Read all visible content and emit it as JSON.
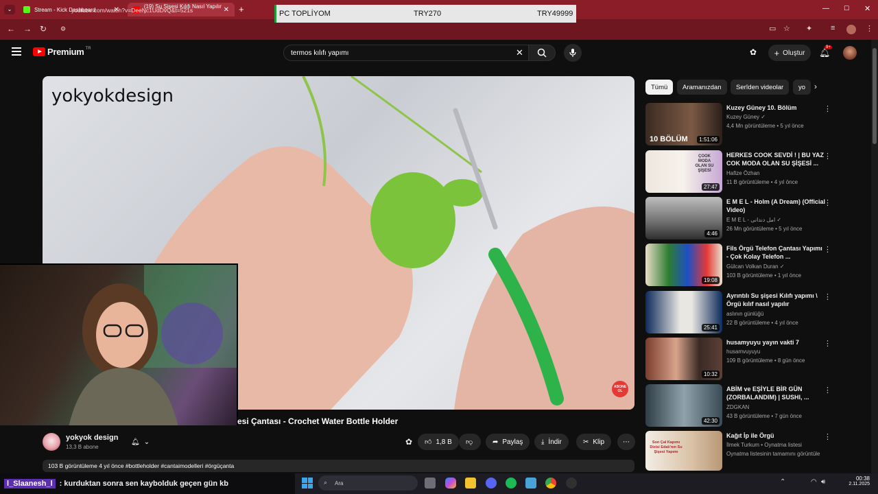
{
  "browser": {
    "tabs": [
      {
        "title": "Stream - Kick Dashboard",
        "color": "#53fc18"
      },
      {
        "title": "(19) Su Şişesi Kılıfı Nasıl Yapılır -",
        "color": "#ff0000"
      }
    ],
    "url": "youtube.com/watch?v=DeeNc1UdDvQ&t=521s"
  },
  "ad_overlay": {
    "label": "PC TOPLİYOM",
    "current": "TRY270",
    "goal": "TRY49999"
  },
  "youtube": {
    "logo_label": "Premium",
    "logo_region": "TR",
    "search_query": "termos kılıfı yapımı",
    "create_label": "Oluştur",
    "notif_count": "9+"
  },
  "video": {
    "watermark": "yokyokdesign",
    "title_visible": "esi Çantası - Crochet Water Bottle Holder",
    "channel": "yokyok design",
    "subs": "13,3 B abone",
    "likes": "1,8 B",
    "share_label": "Paylaş",
    "download_label": "İndir",
    "clip_label": "Klip",
    "description": "103 B görüntüleme  4 yıl önce  #bottleholder #cantaimodelleri #örgüçanta",
    "subscribe_badge": "ABONE OL"
  },
  "sidebar": {
    "chips": [
      "Tümü",
      "Aramanızdan",
      "Serîden videolar",
      "yo"
    ],
    "recos": [
      {
        "title": "Kuzey Güney 10. Bölüm",
        "channel": "Kuzey Güney ✓",
        "meta": "4,4 Mn görüntüleme • 5 yıl önce",
        "duration": "1:51:06",
        "color": "#5b3f2f"
      },
      {
        "title": "HERKES COOK SEVDİ ! | BU YAZ COK MODA OLAN SU ŞİŞESİ ...",
        "channel": "Hafize Özhan",
        "meta": "11 B görüntüleme • 4 yıl önce",
        "duration": "27:47",
        "color": "#e9e3dc"
      },
      {
        "title": "E M E L - Holm (A Dream) (Official Video)",
        "channel": "E M E L - امل دندانی ✓",
        "meta": "26 Mn görüntüleme • 5 yıl önce",
        "duration": "4:46",
        "color": "#777"
      },
      {
        "title": "Fils Örgü Telefon Çantası Yapımı - Çok Kolay Telefon ...",
        "channel": "Gülcan Volkan Duran ✓",
        "meta": "103 B görüntüleme • 1 yıl önce",
        "duration": "19:08",
        "color": "#e9e1cf"
      },
      {
        "title": "Ayrıntılı Su şişesi Kılıfı yapımı \\ Örgü kılıf nasıl yapılır",
        "channel": "aslının günlüğü",
        "meta": "22 B görüntüleme • 4 yıl önce",
        "duration": "25:41",
        "color": "#12346b"
      },
      {
        "title": "husamyuyu yayın vakti 7",
        "channel": "husamvuyuyu",
        "meta": "109 B görüntüleme • 8 gün önce",
        "duration": "10:32",
        "color": "#6a3c33"
      },
      {
        "title": "ABİM ve EŞİYLE BİR GÜN (ZORBALANDIM) | SUSHI, ...",
        "channel": "ZDGKAN",
        "meta": "43 B görüntüleme • 7 gün önce",
        "duration": "42:30",
        "color": "#3a4b55"
      },
      {
        "title": "Kağıt İp ile Örgü",
        "channel": "İlmek Turkum • Oynatma listesi",
        "meta": "Oynatma listesinin tamamını görüntüle",
        "duration": "",
        "color": "#efe9e1"
      }
    ]
  },
  "reco_thumb_text": {
    "r1": "10 BÖLÜM",
    "r2": "ÇOOK MODA OLAN SU ŞİŞESİ",
    "r8": "Son Çal Kapımı Dizisi Edalı'nın Su Şişesi Yapımı"
  },
  "chat": {
    "user": "l_Slaanesh_l",
    "message": ": kurduktan sonra sen kaybolduk geçen gün kb"
  },
  "taskbar": {
    "search_placeholder": "Ara",
    "time": "00:38",
    "date": "2.11.2025"
  }
}
